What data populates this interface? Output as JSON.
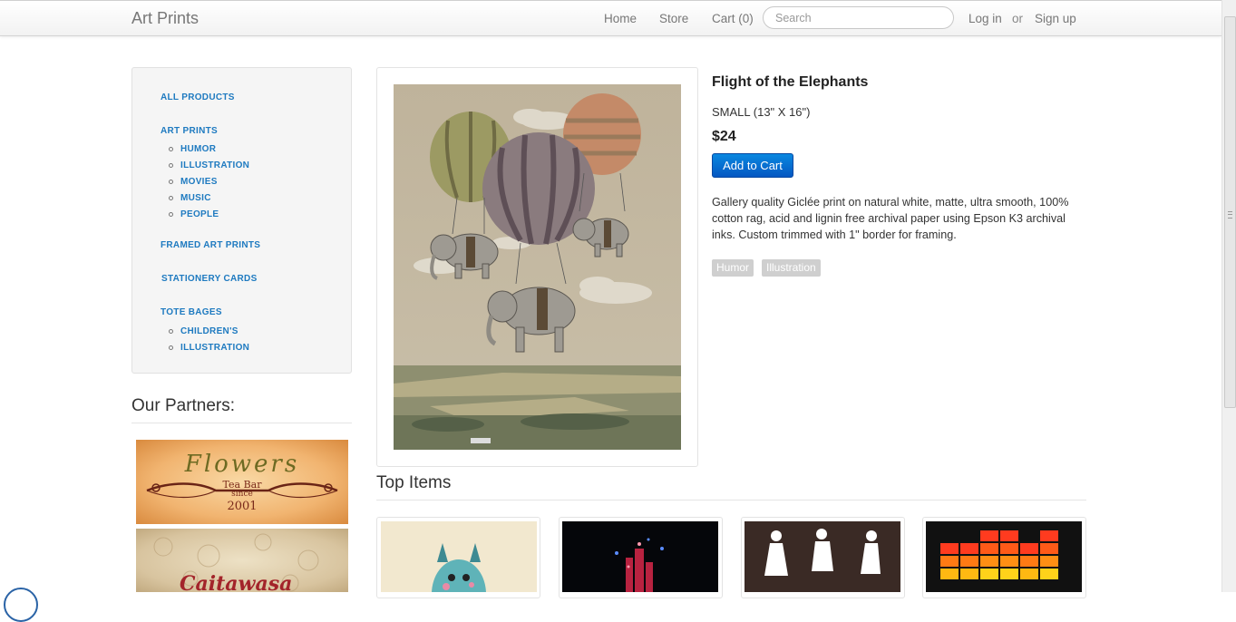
{
  "navbar": {
    "brand": "Art Prints",
    "links": [
      "Home",
      "Store",
      "Cart (0)"
    ],
    "search_placeholder": "Search",
    "login": "Log in",
    "or": "or",
    "signup": "Sign up"
  },
  "sidebar": {
    "categories": [
      {
        "label": "ALL PRODUCTS",
        "children": []
      },
      {
        "label": "ART PRINTS",
        "children": [
          "HUMOR",
          "ILLUSTRATION",
          "MOVIES",
          "MUSIC",
          "PEOPLE"
        ]
      },
      {
        "label": "FRAMED ART PRINTS",
        "children": []
      },
      {
        "label": "STATIONERY CARDS",
        "children": []
      },
      {
        "label": "TOTE BAGES",
        "children": [
          "CHILDREN'S",
          "ILLUSTRATION"
        ]
      }
    ]
  },
  "partners": {
    "title": "Our Partners:",
    "flowers": {
      "name": "Flowers",
      "line1": "Tea Bar",
      "line2": "since",
      "line3": "2001"
    },
    "second": {
      "name": "Caitawasa"
    }
  },
  "product": {
    "title": "Flight of the Elephants",
    "size": "SMALL (13\" X 16\")",
    "price": "$24",
    "add_to_cart": "Add to Cart",
    "description": "Gallery quality Giclée print on natural white, matte, ultra smooth, 100% cotton rag, acid and lignin free archival paper using Epson K3 archival inks. Custom trimmed with 1\" border for framing.",
    "tags": [
      "Humor",
      "Illustration"
    ]
  },
  "top_items": {
    "title": "Top Items",
    "items": [
      {
        "art": "totoro-print"
      },
      {
        "art": "city-lights-print"
      },
      {
        "art": "silhouette-figures-print"
      },
      {
        "art": "equalizer-print"
      }
    ]
  },
  "colors": {
    "link": "#1e7ac0",
    "button": "#0a6fd6",
    "tag": "#cfcfcf"
  }
}
